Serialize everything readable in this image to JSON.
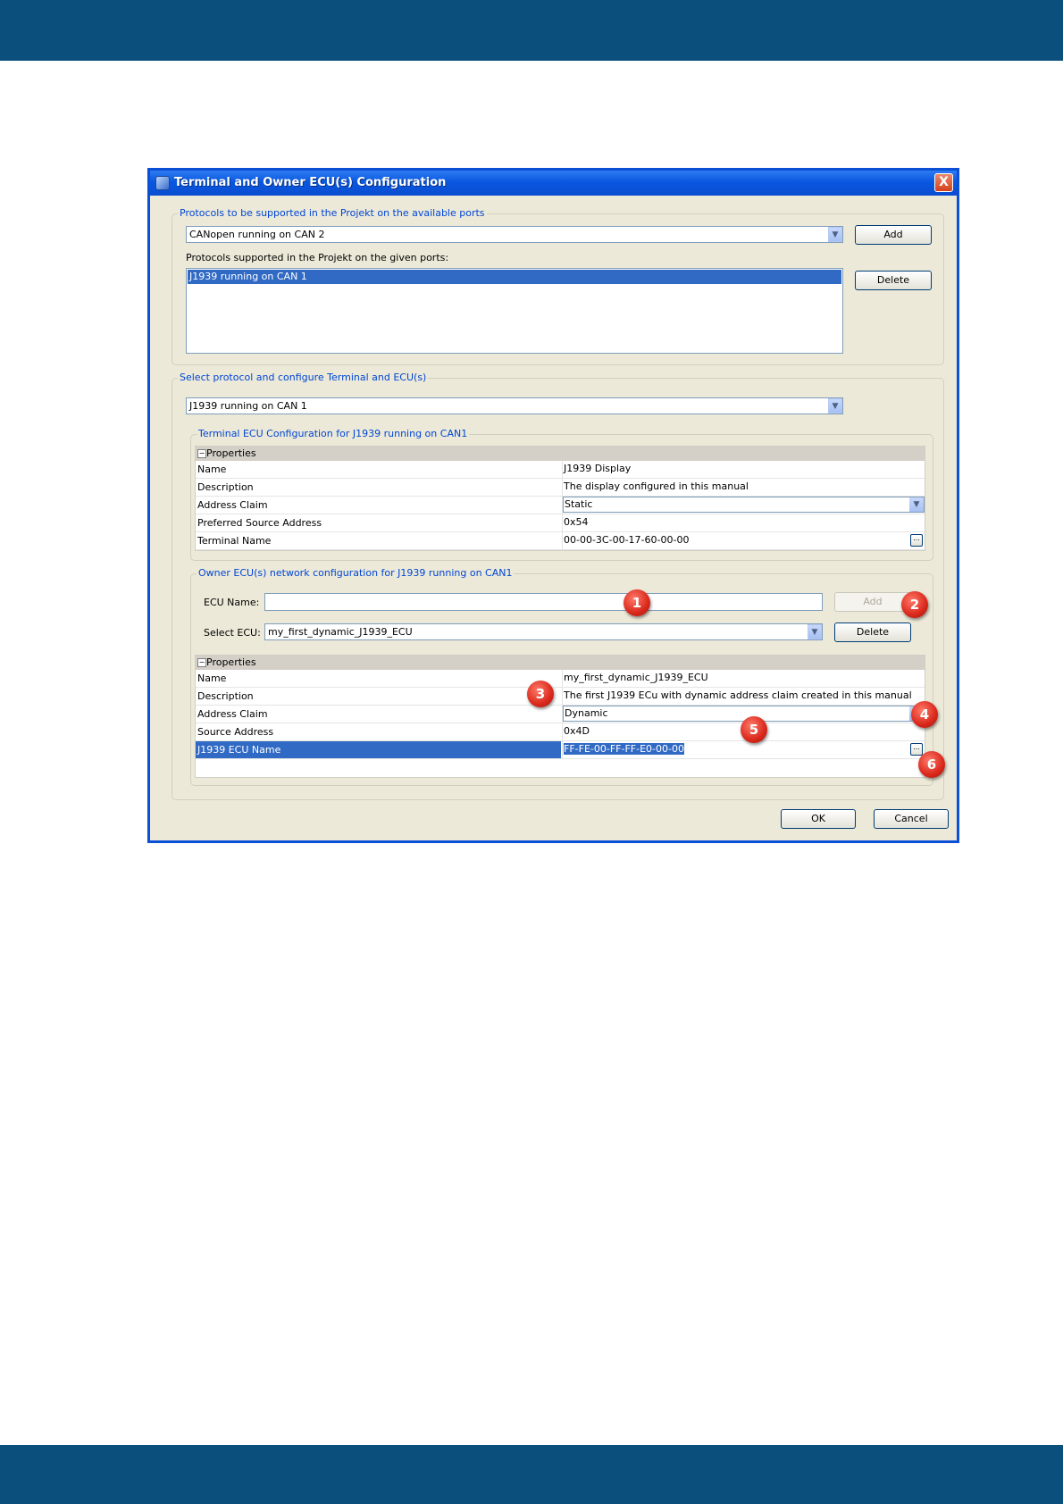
{
  "dialog": {
    "title": "Terminal and Owner ECU(s) Configuration",
    "close_label": "X"
  },
  "protocols": {
    "group_title": "Protocols to be supported in the Projekt on the available ports",
    "available_selected": "CANopen running on CAN 2",
    "add_label": "Add",
    "supported_label": "Protocols supported in the Projekt on the given ports:",
    "supported_items": [
      "J1939 running on CAN 1"
    ],
    "delete_label": "Delete"
  },
  "configure": {
    "group_title": "Select protocol and configure Terminal and ECU(s)",
    "selected_protocol": "J1939 running on CAN 1",
    "terminal": {
      "group_title": "Terminal ECU Configuration for J1939 running on CAN1",
      "properties_header": "Properties",
      "rows": [
        {
          "name": "Name",
          "value": "J1939 Display"
        },
        {
          "name": "Description",
          "value": "The display configured in this manual"
        },
        {
          "name": "Address Claim",
          "value": "Static"
        },
        {
          "name": "Preferred Source Address",
          "value": "0x54"
        },
        {
          "name": "Terminal Name",
          "value": "00-00-3C-00-17-60-00-00"
        }
      ]
    },
    "owner": {
      "group_title": "Owner ECU(s) network configuration  for J1939 running on CAN1",
      "ecu_name_label": "ECU Name:",
      "ecu_name_value": "",
      "add_label": "Add",
      "select_ecu_label": "Select ECU:",
      "selected_ecu": "my_first_dynamic_J1939_ECU",
      "delete_label": "Delete",
      "properties_header": "Properties",
      "rows": [
        {
          "name": "Name",
          "value": "my_first_dynamic_J1939_ECU"
        },
        {
          "name": "Description",
          "value": "The first J1939 ECu with dynamic address claim created in this manual"
        },
        {
          "name": "Address Claim",
          "value": "Dynamic"
        },
        {
          "name": "Source Address",
          "value": "0x4D"
        },
        {
          "name": "J1939 ECU Name",
          "value": "FF-FE-00-FF-FF-E0-00-00"
        }
      ]
    }
  },
  "footer": {
    "ok_label": "OK",
    "cancel_label": "Cancel"
  },
  "markers": [
    "1",
    "2",
    "3",
    "4",
    "5",
    "6"
  ],
  "colors": {
    "band": "#0b4f7c",
    "dialog_bg": "#ece9d8",
    "group_title": "#0046d5",
    "selection": "#316ac5",
    "marker": "#d9281b"
  },
  "icons": {
    "dropdown": "chevron-down-icon",
    "ellipsis": "ellipsis-icon",
    "collapse": "minus-box-icon",
    "close": "close-icon",
    "app": "app-icon"
  }
}
